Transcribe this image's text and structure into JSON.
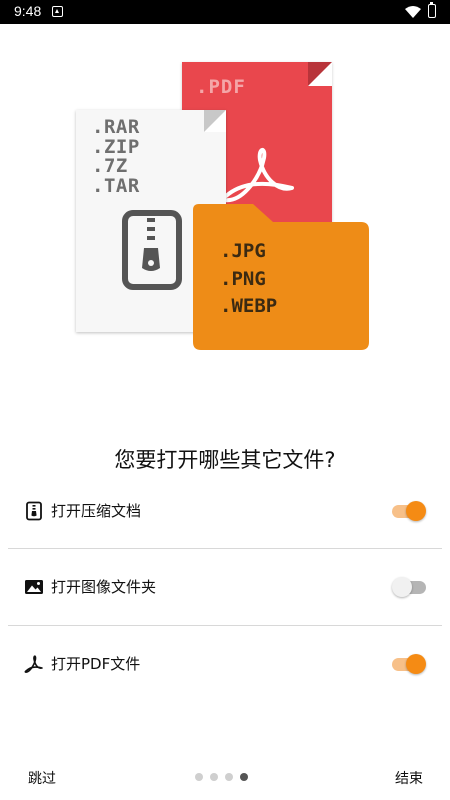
{
  "status_bar": {
    "time": "9:48"
  },
  "illustration": {
    "archive_extensions": [
      ".RAR",
      ".ZIP",
      ".7Z",
      ".TAR"
    ],
    "pdf_extension": ".PDF",
    "image_extensions": [
      ".JPG",
      ".PNG",
      ".WEBP"
    ],
    "colors": {
      "pdf_doc": "#e9474d",
      "folder": "#ee8c17",
      "archive_doc": "#f7f7f7"
    }
  },
  "question": "您要打开哪些其它文件?",
  "options": [
    {
      "label": "打开压缩文档",
      "icon": "archive-icon",
      "enabled": true
    },
    {
      "label": "打开图像文件夹",
      "icon": "image-icon",
      "enabled": false
    },
    {
      "label": "打开PDF文件",
      "icon": "pdf-icon",
      "enabled": true
    }
  ],
  "footer": {
    "skip_label": "跳过",
    "finish_label": "结束",
    "page_count": 4,
    "current_page": 4
  },
  "accent_color": "#f58b14"
}
